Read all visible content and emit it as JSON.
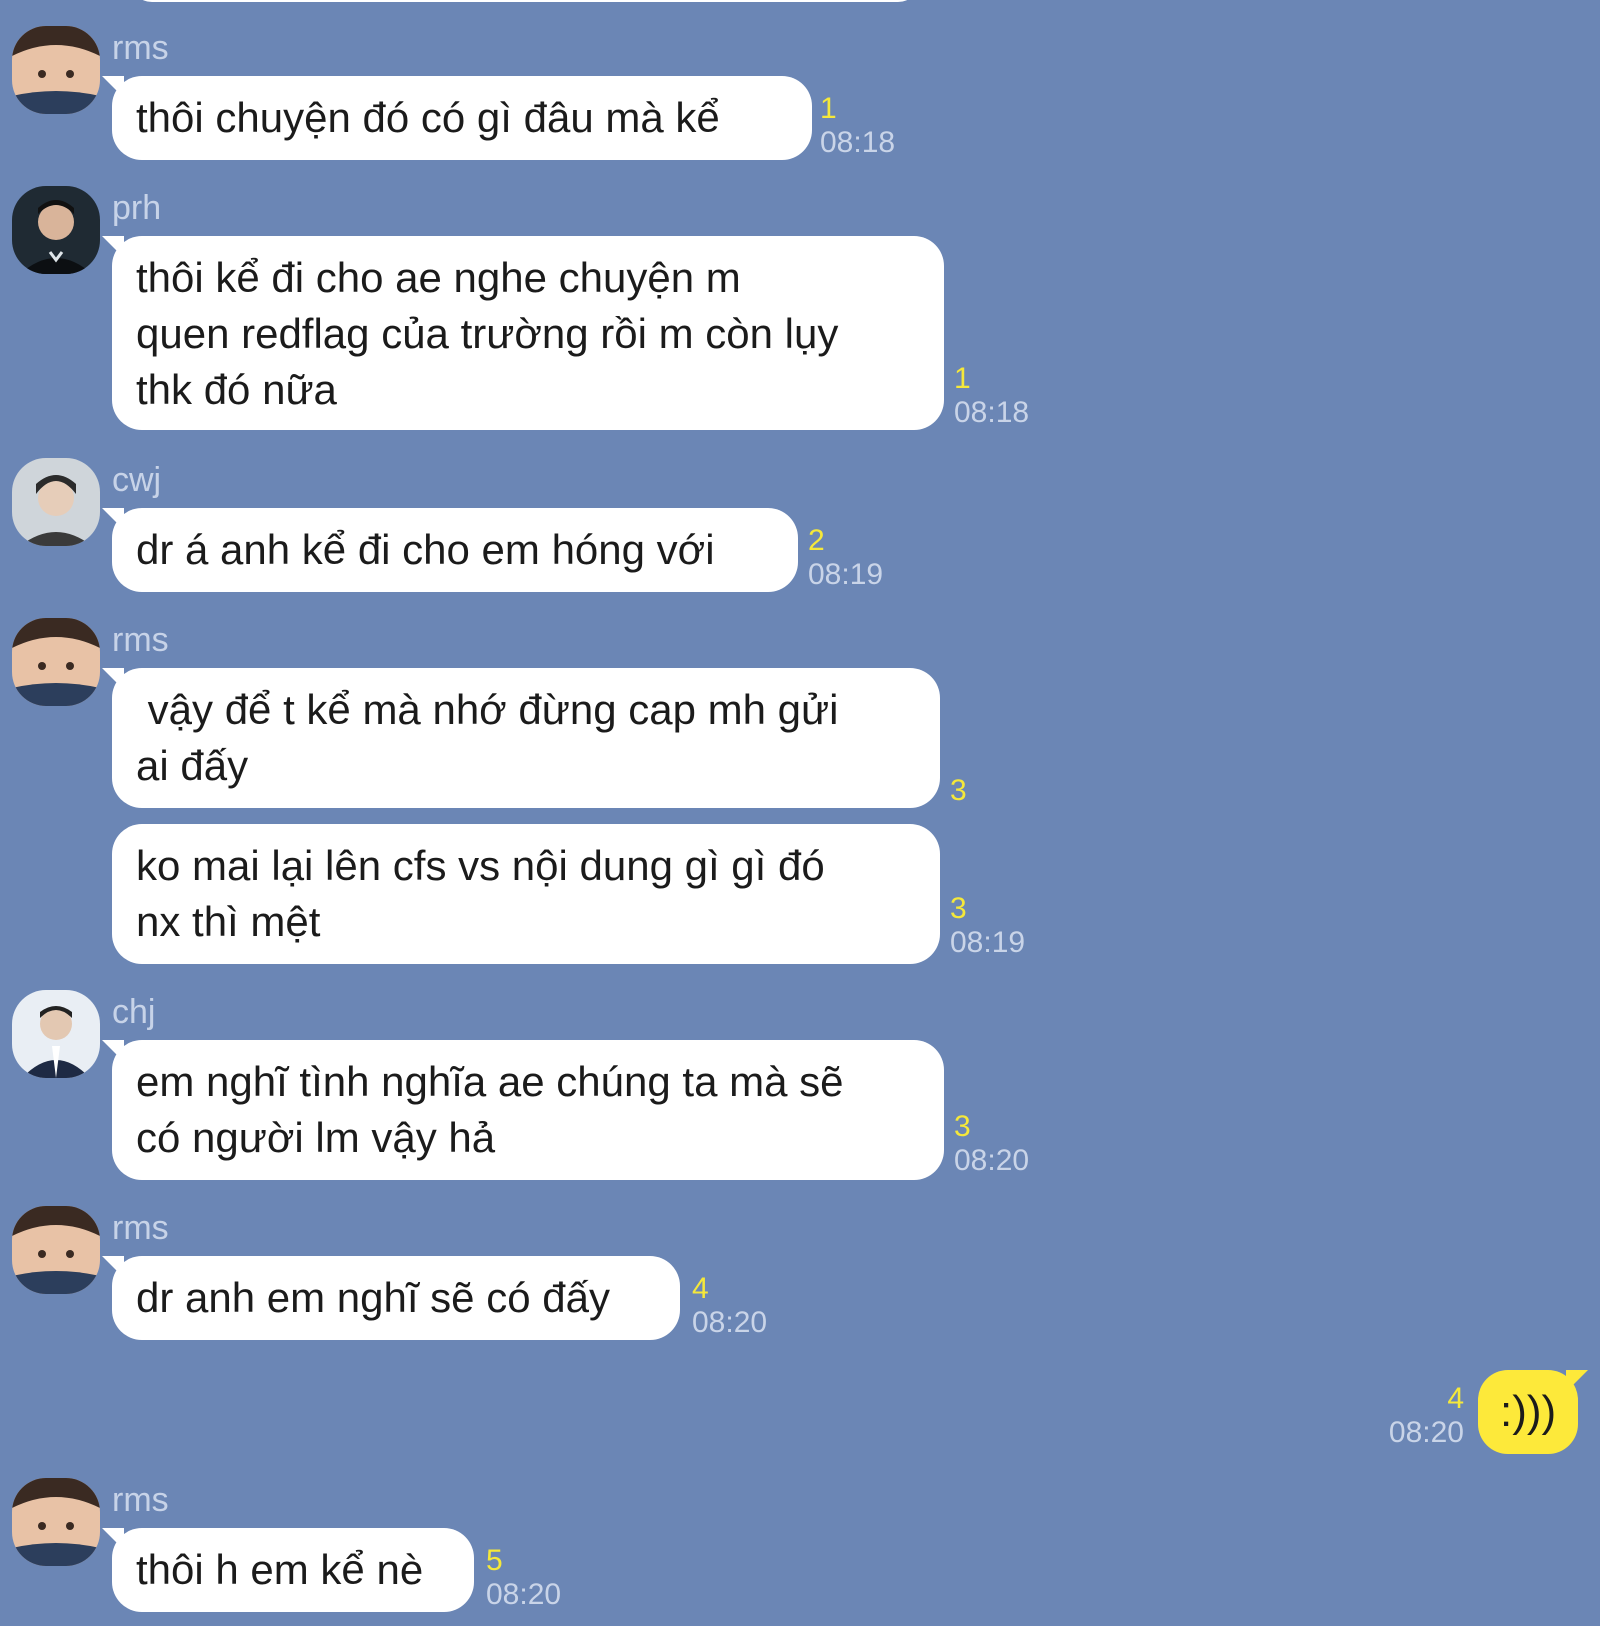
{
  "messages": [
    {
      "sender": "rms",
      "avatar_icon": "person-avatar-icon",
      "text": "thôi chuyện đó có gì đâu mà kể",
      "unread": "1",
      "time": "08:18"
    },
    {
      "sender": "prh",
      "avatar_icon": "person-avatar-icon",
      "text": "thôi kể đi cho ae nghe chuyện m\nquen redflag của trường rồi m còn lụy\nthk đó nữa",
      "unread": "1",
      "time": "08:18"
    },
    {
      "sender": "cwj",
      "avatar_icon": "person-avatar-icon",
      "text": "dr á anh kể đi cho em hóng với",
      "unread": "2",
      "time": "08:19"
    },
    {
      "sender": "rms",
      "avatar_icon": "person-avatar-icon",
      "text": " vậy để t kể mà nhớ đừng cap mh gửi\nai đấy",
      "unread": "3",
      "time": ""
    },
    {
      "sender": "",
      "avatar_icon": "",
      "text": "ko mai lại lên cfs vs nội dung gì gì đó\nnx thì mệt",
      "unread": "3",
      "time": "08:19"
    },
    {
      "sender": "chj",
      "avatar_icon": "person-avatar-icon",
      "text": "em nghĩ tình nghĩa ae chúng ta mà sẽ\ncó người lm vậy hả",
      "unread": "3",
      "time": "08:20"
    },
    {
      "sender": "rms",
      "avatar_icon": "person-avatar-icon",
      "text": "dr anh em nghĩ sẽ có đấy",
      "unread": "4",
      "time": "08:20"
    },
    {
      "sender": "rms",
      "avatar_icon": "person-avatar-icon",
      "text": "thôi h em kể nè",
      "unread": "5",
      "time": "08:20"
    }
  ],
  "my_message": {
    "text": ":)))",
    "unread": "4",
    "time": "08:20"
  },
  "colors": {
    "background": "#6b86b5",
    "incoming_bubble": "#ffffff",
    "outgoing_bubble": "#fde93a",
    "unread_count": "#f5e83a",
    "timestamp": "#c9d4e8"
  }
}
